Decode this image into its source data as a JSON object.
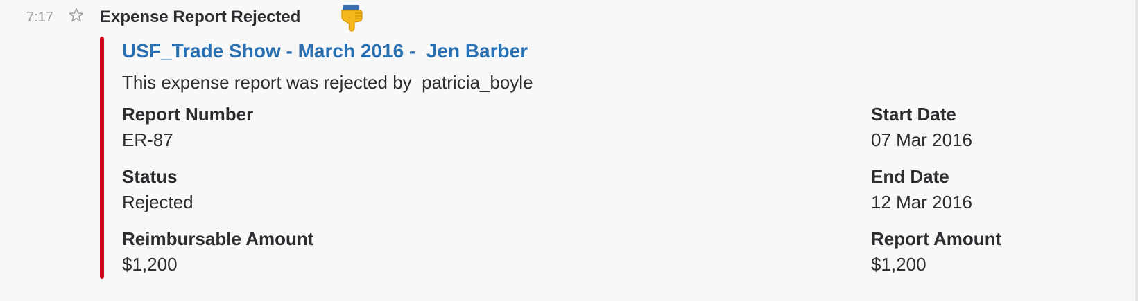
{
  "message": {
    "time": "7:17",
    "star_icon": "star-outline-icon",
    "title": "Expense Report Rejected",
    "emoji_icon": "thumbs-down-icon"
  },
  "attachment": {
    "accent_color": "#d0021b",
    "link_color": "#2a70b0",
    "title": "USF_Trade Show - March 2016 -  Jen Barber",
    "text_prefix": "This expense report was rejected by",
    "rejected_by": "patricia_boyle",
    "fields": {
      "report_number": {
        "label": "Report Number",
        "value": "ER-87"
      },
      "start_date": {
        "label": "Start Date",
        "value": "07 Mar 2016"
      },
      "status": {
        "label": "Status",
        "value": "Rejected"
      },
      "end_date": {
        "label": "End Date",
        "value": "12 Mar 2016"
      },
      "reimbursable_amount": {
        "label": "Reimbursable Amount",
        "value": "$1,200"
      },
      "report_amount": {
        "label": "Report Amount",
        "value": "$1,200"
      }
    }
  }
}
